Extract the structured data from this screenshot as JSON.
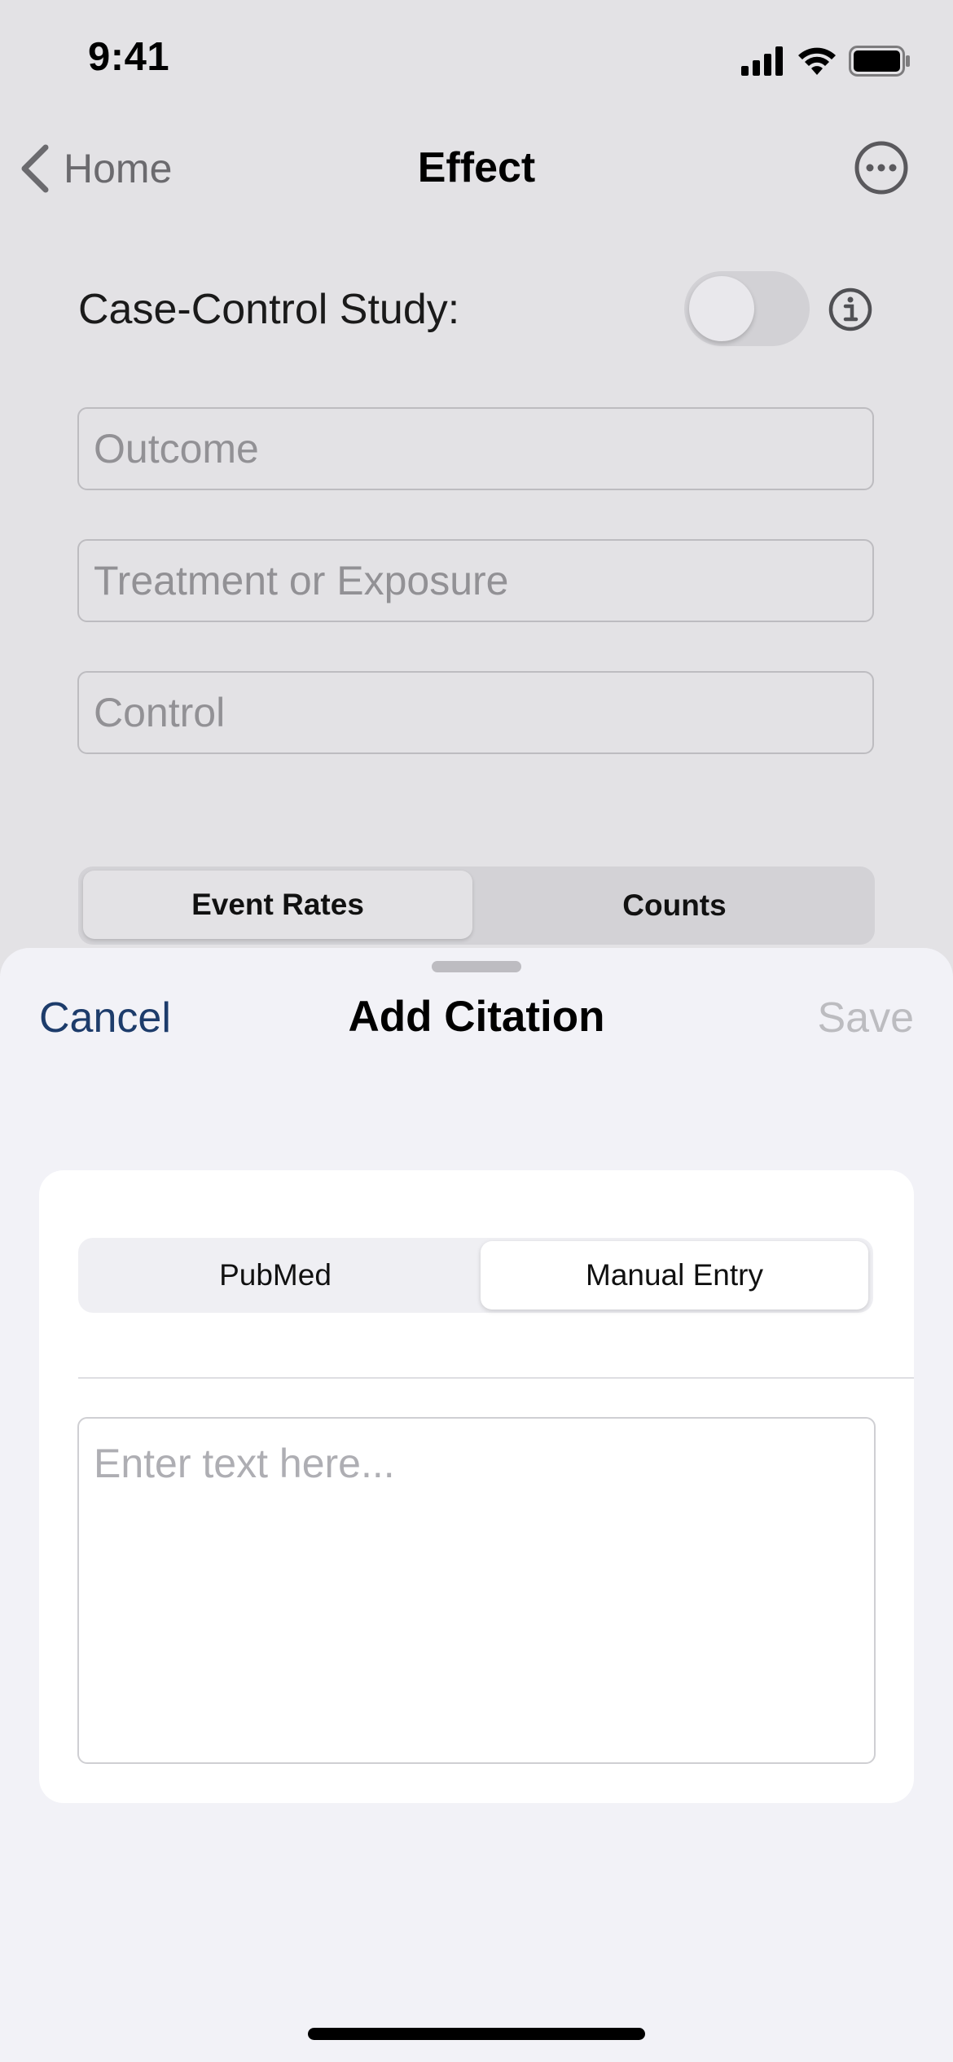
{
  "status_bar": {
    "time": "9:41",
    "icons": [
      "cellular-signal-icon",
      "wifi-icon",
      "battery-icon"
    ]
  },
  "nav": {
    "back_label": "Home",
    "title": "Effect",
    "more_icon": "ellipsis-circle-icon"
  },
  "form": {
    "case_control_label": "Case-Control Study:",
    "case_control_on": false,
    "outcome_placeholder": "Outcome",
    "treatment_placeholder": "Treatment or Exposure",
    "control_placeholder": "Control",
    "mode_segments": [
      "Event Rates",
      "Counts"
    ],
    "mode_selected": "Event Rates"
  },
  "sheet": {
    "cancel_label": "Cancel",
    "title": "Add Citation",
    "save_label": "Save",
    "source_segments": [
      "PubMed",
      "Manual Entry"
    ],
    "source_selected": "Manual Entry",
    "text_placeholder": "Enter text here..."
  },
  "colors": {
    "background": "#e3e2e5",
    "sheet": "#f2f2f7",
    "accent_cancel": "#1d3c6b",
    "disabled_save": "#bcbcc0"
  }
}
